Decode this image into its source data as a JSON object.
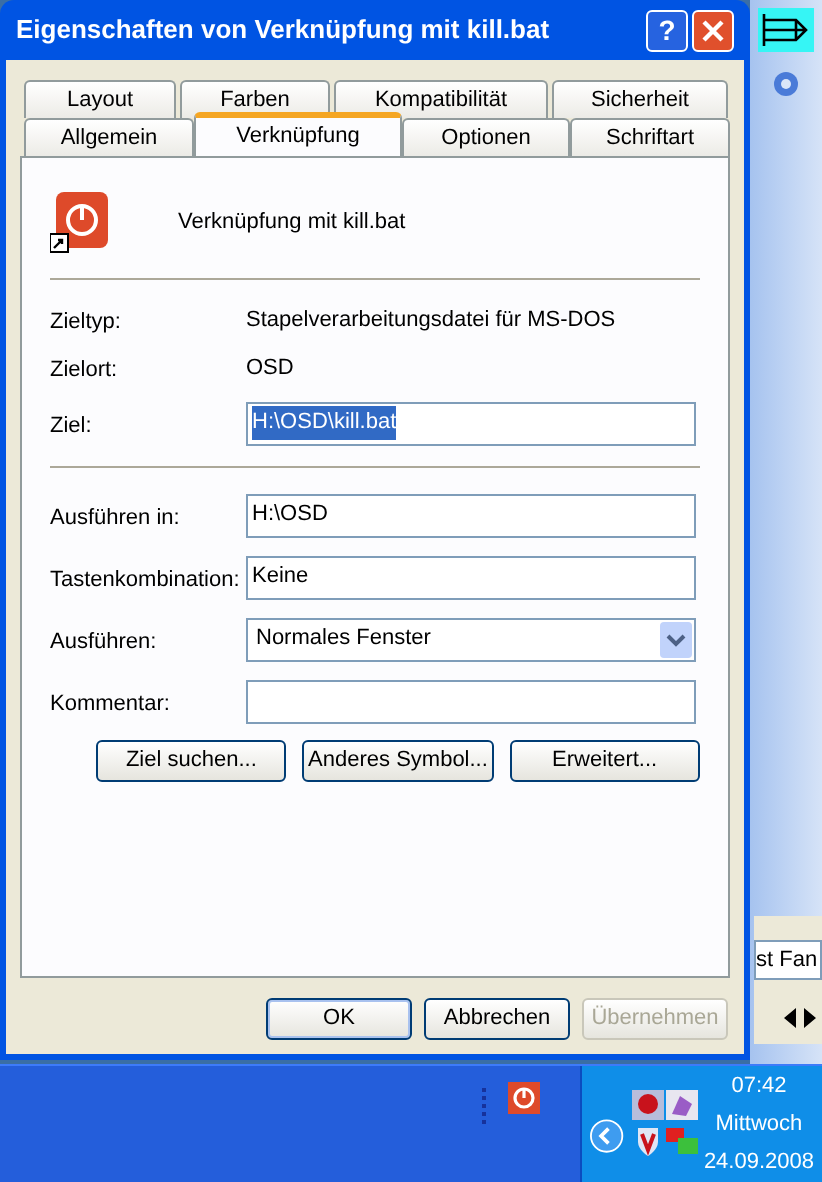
{
  "window": {
    "title": "Eigenschaften von Verknüpfung mit kill.bat",
    "help_button": "?"
  },
  "tabs": [
    [
      {
        "label": "Layout",
        "selected": false
      },
      {
        "label": "Farben",
        "selected": false
      },
      {
        "label": "Kompatibilität",
        "selected": false
      },
      {
        "label": "Sicherheit",
        "selected": false
      }
    ],
    [
      {
        "label": "Allgemein",
        "selected": false
      },
      {
        "label": "Verknüpfung",
        "selected": true
      },
      {
        "label": "Optionen",
        "selected": false
      },
      {
        "label": "Schriftart",
        "selected": false
      }
    ]
  ],
  "header": {
    "name": "Verknüpfung mit kill.bat"
  },
  "sections": [
    [
      {
        "kind": "info",
        "label": "Zieltyp:",
        "value": "Stapelverarbeitungsdatei für MS-DOS"
      },
      {
        "kind": "info",
        "label": "Zielort:",
        "value": "OSD"
      },
      {
        "kind": "input",
        "label": "Ziel:",
        "value": "H:\\OSD\\kill.bat",
        "highlighted": true
      }
    ],
    [
      {
        "kind": "input",
        "label": "Ausführen in:",
        "value": "H:\\OSD",
        "highlighted": false
      },
      {
        "kind": "input",
        "label": "Tastenkombination:",
        "value": "Keine",
        "highlighted": false
      },
      {
        "kind": "select",
        "label": "Ausführen:",
        "value": "Normales Fenster"
      },
      {
        "kind": "input",
        "label": "Kommentar:"
      }
    ]
  ],
  "action_buttons": [
    "Ziel suchen...",
    "Anderes Symbol...",
    "Erweitert..."
  ],
  "dialog_buttons": [
    {
      "label": "OK",
      "disabled": false,
      "default": true
    },
    {
      "label": "Abbrechen",
      "disabled": false,
      "default": false
    },
    {
      "label": "Übernehmen",
      "disabled": true,
      "default": false
    }
  ],
  "background_window": {
    "field_text": "st Fan"
  },
  "taskbar": {
    "time": "07:42",
    "day": "Mittwoch",
    "date": "24.09.2008"
  }
}
